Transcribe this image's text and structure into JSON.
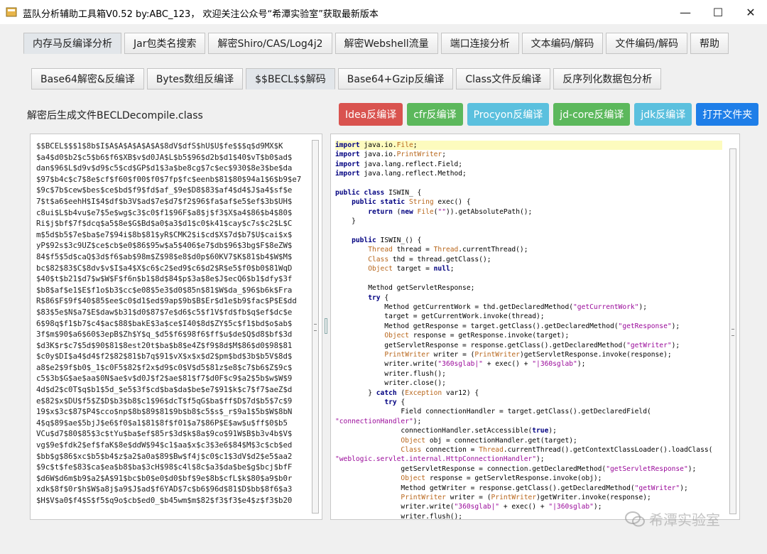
{
  "window": {
    "title": "蓝队分析辅助工具箱V0.52 by:ABC_123， 欢迎关注公众号“希潭实验室”获取最新版本",
    "minimize": "—",
    "maximize": "☐",
    "close": "✕"
  },
  "tabs_top": [
    "内存马反编译分析",
    "Jar包类名搜索",
    "解密Shiro/CAS/Log4j2",
    "解密Webshell流量",
    "端口连接分析",
    "文本编码/解码",
    "文件编码/解码",
    "帮助"
  ],
  "tabs_sub": [
    "Base64解密&反编译",
    "Bytes数组反编译",
    "$$BECL$$解码",
    "Base64+Gzip反编译",
    "Class文件反编译",
    "反序列化数据包分析"
  ],
  "file_label": "解密后生成文件BECLDecompile.class",
  "actions": [
    {
      "label": "Idea反编译",
      "color": "#d9534f"
    },
    {
      "label": "cfr反编译",
      "color": "#5cb85c"
    },
    {
      "label": "Procyon反编译",
      "color": "#5bc0de"
    },
    {
      "label": "jd-core反编译",
      "color": "#5cb85c"
    },
    {
      "label": "jdk反编译",
      "color": "#5bc0de"
    },
    {
      "label": "打开文件夹",
      "color": "#1e7ee8"
    }
  ],
  "left_lines": [
    "$$BCEL$$$1$8b$I$A$A$A$A$A$A$8dV$dfS$hU$U$fe$$$q$d9MX$K",
    "$a4$d0$b2$c5$b6$f6$XB$v$d0JA$L$b5$96$d2b$d1$40$vT$b0$ad$",
    "dan$96$L$d9v$d9$c5$cd$GP$d1$3a$be8cg$7c$ec$930$8e3$be$da",
    "$97$b4c$c7$8e$cf$f60$f00$f0$7fp$fc$eenb$81$80$94a1$6$b9$e7",
    "$9c$7b$cew$bes$ce$bd$f9$fd$af_$9e$D8$83$af4$d4$J$a4$sf$e",
    "7$t$a6$eehH$I$4$df$b3V$ad$7e$d7$f2$96$fa$af$e5$ef$3b$UH$",
    "c8ui$L$b4vu$e7$5e$wg$c3$c0$f1$96F$a8$j$f3$X$a4$86$b4$80$",
    "Ri$j$bf$7f$dcq$a5$8e$G$Bd$a0$a3$d1$c0$k41$cay$c7s$c2$L$C",
    "m$5d$b5$7e$ba$e7$94i$8b$81$yR$CMK2$i$cd$X$7d$b7$U$cai$x$",
    "yP$92s$3c9UZ$ce$cb$e0$86$95w$a5$406$e7$db$96$3bg$F$8eZW$",
    "84$f5$5d$caQ$3d$f6$ab$98m$Z$98$e8$d0p$60KV7$K$81$b4$W$M$",
    "bc$82$83$C$8dv$v$I$a4$X$c6$c2$ed9$c6$d2$R$e5$f0$b0$81WqD",
    "$40$t$b21$d7$w$W$F$f6n$b1$8d$84$p$3a$8e$J$ecQ6$b1$dfy$3f",
    "$b8$af$e1$E$f1o$b3$cc$e08$5e3$d0$85n$81$W$da_$96$b6k$Fra",
    "R$86$F$9f$40$85$ee$c0$d1$ed$9ap$9b$B$Er$d1e$b9$fac$P$E$dd",
    "$83$5e$N$a7$E$daw$b31$d0$87$7e$d6$c5$f1V$fd$fb$q$ef$dc$e",
    "6$98q$f1$b7$c4$ac$88$bakE$3a$ce$I40$8d$ZY$5c$f1$bd$o$ab$",
    "3f$m$90$a6$60$3epB$Zh$Y$q_$d5$f6$98f6$ff$u$de$Q$d8$bf$3d",
    "$d3K$r$c7$5d$90$81$8est20t$ba$b8$e4Z$f9$8d$M$86$d0$98$81",
    "$c0y$DI$a4$d4$f2$82$81$b7q$91$vX$x$x$d2$pm$bd$3b$b5V$8d$",
    "a8$e2$9f$b0$_1$c0F5$82$f2x$d9$c0$V$d5$81z$e8$c7$b6$Z$9c$",
    "c5$3b$G$ae$aa$0N$ae$v$d0J$f2$ae$81$f7$d0F$c9$a2$5b$w$W$9",
    "4d$d2$c0T$q$b1$5d_$e5$3f$cd$ba$da$be$e7$91$k$c7$f7$aeZ$d",
    "e$82$x$DU$f5$Z$D$b3$b8$c1$96$dcT$f5qG$ba$ff$D$7d$b5$7c$9",
    "19$x$3c$87$P4$cco$np$8b$89$81$9b$b8$c5$s$_r$9a1$5b$W$8bN",
    "4$q$89$ae$5bjJ$e6$f0$a1$81$8f$f01$a7$86P$E$aw$u$ff$0$b5",
    "VCu$d7$80$85$3c$tYu$ba$ef$85r$3d$k$8a$9co$91W$B$b3v4b$V$",
    "vg$9e$fdk2$ef$faK$8e$ddW$94$c1$aa$x$c3$3e6$84$M$3c$cb$ed",
    "$bb$g$86$xc$b5$b4$z$a2$a0a$89$Bw$f4j$c0$c1$3dV$d2$e5$aa2",
    "$9c$t$fe$83$ca$ea$b8$ba$3cH$98$c4l$8c$a3$da$be$g$bcj$bfF",
    "$d6W$d6m$b9$a2$A$91$bc$b0$e0$d0$bf$9e$8b$cfL$k$80$a9$b0r",
    "xdk$8f$0r$h$W$a8j$a9$J$ad$f6YAD$7c$b6$96d$81$D$bb$8f6$a3",
    "$H$V$a0$f4$S$f5$q9o$cb$ed0_$b45wm$m$82$f3$f3$e4$z$f3$b20"
  ],
  "code_lines": [
    [
      [
        "kw",
        "import"
      ],
      [
        "tx",
        " java.io."
      ],
      [
        "ty",
        "File"
      ],
      [
        "tx",
        ";"
      ]
    ],
    [
      [
        "kw",
        "import"
      ],
      [
        "tx",
        " java.io."
      ],
      [
        "ty",
        "PrintWriter"
      ],
      [
        "tx",
        ";"
      ]
    ],
    [
      [
        "kw",
        "import"
      ],
      [
        "tx",
        " java.lang.reflect.Field;"
      ]
    ],
    [
      [
        "kw",
        "import"
      ],
      [
        "tx",
        " java.lang.reflect.Method;"
      ]
    ],
    [],
    [
      [
        "kw",
        "public class"
      ],
      [
        "tx",
        " ISWIN_ {"
      ]
    ],
    [
      [
        "tx",
        "    "
      ],
      [
        "kw",
        "public static"
      ],
      [
        "ty",
        " String"
      ],
      [
        "tx",
        " exec() {"
      ]
    ],
    [
      [
        "tx",
        "        "
      ],
      [
        "kw",
        "return"
      ],
      [
        "tx",
        " ("
      ],
      [
        "kw",
        "new"
      ],
      [
        "ty",
        " File"
      ],
      [
        "tx",
        "("
      ],
      [
        "st",
        "\"\""
      ],
      [
        "tx",
        ")).getAbsolutePath();"
      ]
    ],
    [
      [
        "tx",
        "    }"
      ]
    ],
    [],
    [
      [
        "tx",
        "    "
      ],
      [
        "kw",
        "public"
      ],
      [
        "tx",
        " ISWIN_() {"
      ]
    ],
    [
      [
        "tx",
        "        "
      ],
      [
        "ty",
        "Thread"
      ],
      [
        "tx",
        " thread = "
      ],
      [
        "ty",
        "Thread"
      ],
      [
        "tx",
        ".currentThread();"
      ]
    ],
    [
      [
        "tx",
        "        "
      ],
      [
        "ty",
        "Class"
      ],
      [
        "tx",
        " thd = thread.getClass();"
      ]
    ],
    [
      [
        "tx",
        "        "
      ],
      [
        "ty",
        "Object"
      ],
      [
        "tx",
        " target = "
      ],
      [
        "kw",
        "null"
      ],
      [
        "tx",
        ";"
      ]
    ],
    [],
    [
      [
        "tx",
        "        Method getServletResponse;"
      ]
    ],
    [
      [
        "tx",
        "        "
      ],
      [
        "kw",
        "try"
      ],
      [
        "tx",
        " {"
      ]
    ],
    [
      [
        "tx",
        "            Method getCurrentWork = thd.getDeclaredMethod("
      ],
      [
        "st",
        "\"getCurrentWork\""
      ],
      [
        "tx",
        ");"
      ]
    ],
    [
      [
        "tx",
        "            target = getCurrentWork.invoke(thread);"
      ]
    ],
    [
      [
        "tx",
        "            Method getResponse = target.getClass().getDeclaredMethod("
      ],
      [
        "st",
        "\"getResponse\""
      ],
      [
        "tx",
        ");"
      ]
    ],
    [
      [
        "tx",
        "            "
      ],
      [
        "ty",
        "Object"
      ],
      [
        "tx",
        " response = getResponse.invoke(target);"
      ]
    ],
    [
      [
        "tx",
        "            getServletResponse = response.getClass().getDeclaredMethod("
      ],
      [
        "st",
        "\"getWriter\""
      ],
      [
        "tx",
        ");"
      ]
    ],
    [
      [
        "tx",
        "            "
      ],
      [
        "ty",
        "PrintWriter"
      ],
      [
        "tx",
        " writer = ("
      ],
      [
        "ty",
        "PrintWriter"
      ],
      [
        "tx",
        ")getServletResponse.invoke(response);"
      ]
    ],
    [
      [
        "tx",
        "            writer.write("
      ],
      [
        "st",
        "\"360sglab|\""
      ],
      [
        "tx",
        " + exec() + "
      ],
      [
        "st",
        "\"|360sglab\""
      ],
      [
        "tx",
        ");"
      ]
    ],
    [
      [
        "tx",
        "            writer.flush();"
      ]
    ],
    [
      [
        "tx",
        "            writer.close();"
      ]
    ],
    [
      [
        "tx",
        "        } "
      ],
      [
        "kw",
        "catch"
      ],
      [
        "tx",
        " ("
      ],
      [
        "ty",
        "Exception"
      ],
      [
        "tx",
        " var12) {"
      ]
    ],
    [
      [
        "tx",
        "            "
      ],
      [
        "kw",
        "try"
      ],
      [
        "tx",
        " {"
      ]
    ],
    [
      [
        "tx",
        "                Field connectionHandler = target.getClass().getDeclaredField("
      ]
    ],
    [
      [
        "st",
        "\"connectionHandler\""
      ],
      [
        "tx",
        ");"
      ]
    ],
    [
      [
        "tx",
        "                connectionHandler.setAccessible("
      ],
      [
        "kw",
        "true"
      ],
      [
        "tx",
        ");"
      ]
    ],
    [
      [
        "tx",
        "                "
      ],
      [
        "ty",
        "Object"
      ],
      [
        "tx",
        " obj = connectionHandler.get(target);"
      ]
    ],
    [
      [
        "tx",
        "                "
      ],
      [
        "ty",
        "Class"
      ],
      [
        "tx",
        " connection = "
      ],
      [
        "ty",
        "Thread"
      ],
      [
        "tx",
        ".currentThread().getContextClassLoader().loadClass("
      ]
    ],
    [
      [
        "st",
        "\"weblogic.servlet.internal.HttpConnectionHandler\""
      ],
      [
        "tx",
        ");"
      ]
    ],
    [
      [
        "tx",
        "                getServletResponse = connection.getDeclaredMethod("
      ],
      [
        "st",
        "\"getServletResponse\""
      ],
      [
        "tx",
        ");"
      ]
    ],
    [
      [
        "tx",
        "                "
      ],
      [
        "ty",
        "Object"
      ],
      [
        "tx",
        " response = getServletResponse.invoke(obj);"
      ]
    ],
    [
      [
        "tx",
        "                Method getWriter = response.getClass().getDeclaredMethod("
      ],
      [
        "st",
        "\"getWriter\""
      ],
      [
        "tx",
        ");"
      ]
    ],
    [
      [
        "tx",
        "                "
      ],
      [
        "ty",
        "PrintWriter"
      ],
      [
        "tx",
        " writer = ("
      ],
      [
        "ty",
        "PrintWriter"
      ],
      [
        "tx",
        ")getWriter.invoke(response);"
      ]
    ],
    [
      [
        "tx",
        "                writer.write("
      ],
      [
        "st",
        "\"360sglab|\""
      ],
      [
        "tx",
        " + exec() + "
      ],
      [
        "st",
        "\"|360sglab\""
      ],
      [
        "tx",
        ");"
      ]
    ],
    [
      [
        "tx",
        "                writer.flush();"
      ]
    ]
  ],
  "watermark": "希潭实验室"
}
